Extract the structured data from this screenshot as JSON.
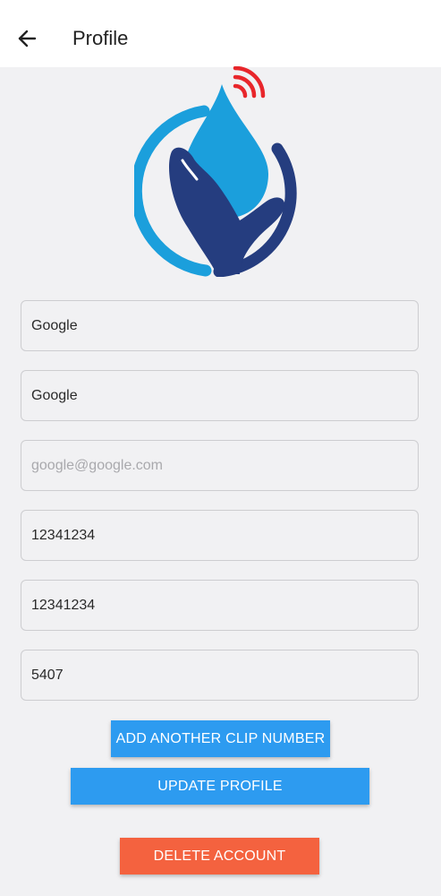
{
  "header": {
    "title": "Profile",
    "back_icon": "arrow-left-icon"
  },
  "logo": {
    "icon": "water-drop-hand-logo",
    "colors": {
      "light_blue": "#1b9fdc",
      "dark_blue": "#253d7f",
      "red": "#e8262b"
    }
  },
  "form": {
    "first_name": {
      "value": "Google",
      "placeholder": ""
    },
    "last_name": {
      "value": "Google",
      "placeholder": ""
    },
    "email": {
      "value": "",
      "placeholder": "google@google.com"
    },
    "phone": {
      "value": "12341234",
      "placeholder": ""
    },
    "phone_2": {
      "value": "12341234",
      "placeholder": ""
    },
    "clip_number": {
      "value": "5407",
      "placeholder": ""
    }
  },
  "buttons": {
    "add_clip_label": "ADD ANOTHER CLIP NUMBER",
    "update_label": "UPDATE PROFILE",
    "delete_label": "DELETE ACCOUNT"
  },
  "colors": {
    "primary": "#2d9bf0",
    "danger": "#f4623f",
    "background": "#f1f1f3"
  }
}
